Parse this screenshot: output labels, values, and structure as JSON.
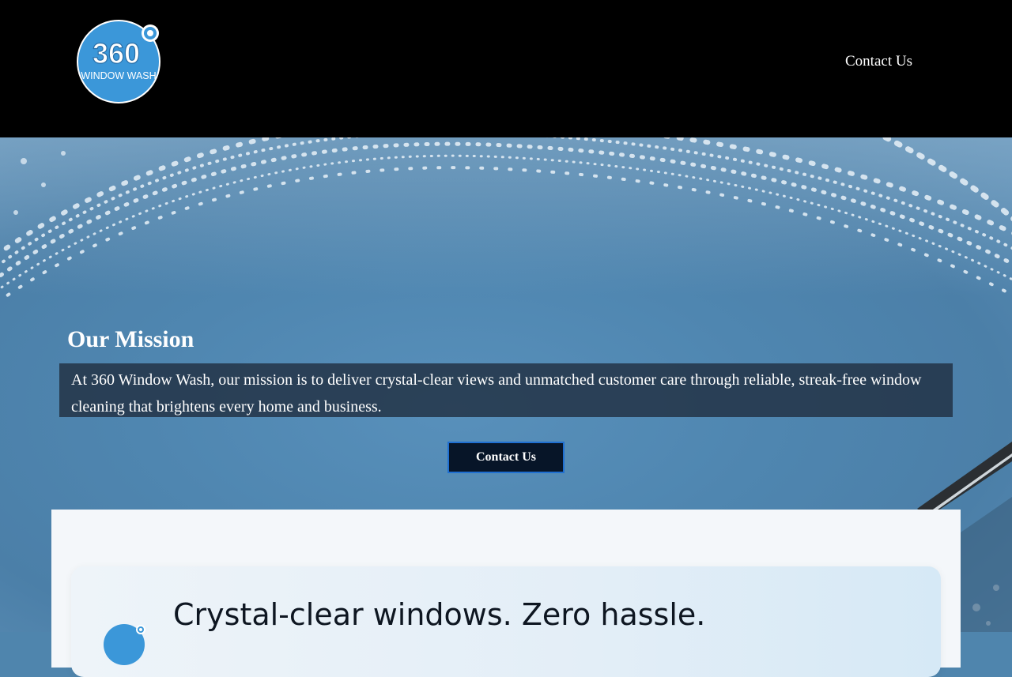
{
  "header": {
    "logo": {
      "number": "360",
      "subtitle": "WINDOW WASH"
    },
    "nav_contact": "Contact Us"
  },
  "hero": {
    "mission_title": "Our Mission",
    "mission_text": "At 360 Window Wash, our mission is to deliver crystal-clear views and unmatched customer care through reliable, streak-free window cleaning that brightens every home and business.",
    "cta_label": "Contact Us"
  },
  "feature": {
    "heading": "Crystal-clear windows. Zero hassle."
  },
  "colors": {
    "logo_blue": "#3b97d9",
    "header_bg": "#000000",
    "cta_bg": "#071528",
    "cta_border": "#1f6fd1"
  }
}
